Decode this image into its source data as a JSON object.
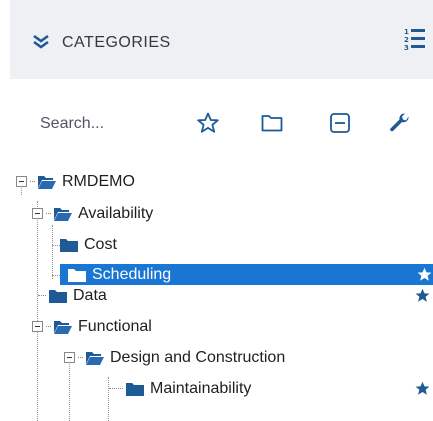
{
  "header": {
    "title": "CATEGORIES"
  },
  "toolbar": {
    "search_placeholder": "Search..."
  },
  "tree": {
    "root": {
      "label": "RMDEMO",
      "expanded": true
    },
    "availability": {
      "label": "Availability",
      "expanded": true
    },
    "cost": {
      "label": "Cost"
    },
    "scheduling": {
      "label": "Scheduling",
      "selected": true,
      "favorite": true
    },
    "data": {
      "label": "Data",
      "favorite": true
    },
    "functional": {
      "label": "Functional",
      "expanded": true
    },
    "design": {
      "label": "Design and Construction",
      "expanded": true
    },
    "maintainability": {
      "label": "Maintainability",
      "favorite": true
    }
  },
  "colors": {
    "accent": "#1976d2",
    "folder": "#1e5a96",
    "header_bg": "#eef0f3",
    "star": "#1e5a96"
  },
  "icons": [
    "chevrons-down-icon",
    "numbered-list-icon",
    "star-outline-icon",
    "folder-outline-icon",
    "collapse-icon",
    "wrench-icon",
    "folder-icon",
    "folder-open-icon",
    "star-icon"
  ]
}
